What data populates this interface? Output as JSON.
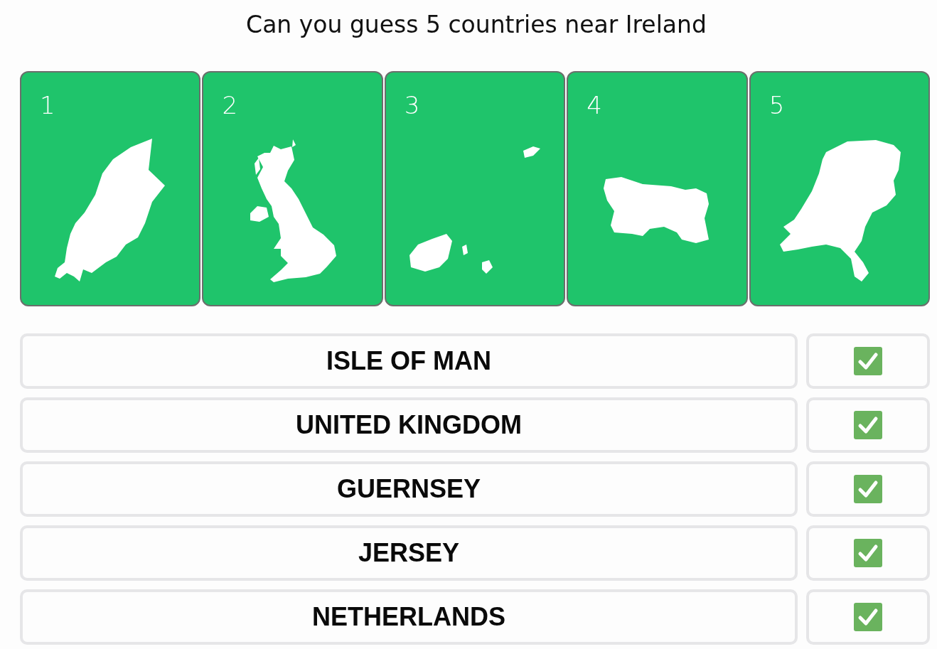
{
  "title": "Can you guess 5 countries near Ireland",
  "cards": [
    {
      "number": "1"
    },
    {
      "number": "2"
    },
    {
      "number": "3"
    },
    {
      "number": "4"
    },
    {
      "number": "5"
    }
  ],
  "answers": [
    {
      "name": "ISLE OF MAN",
      "correct": true
    },
    {
      "name": "UNITED KINGDOM",
      "correct": true
    },
    {
      "name": "GUERNSEY",
      "correct": true
    },
    {
      "name": "JERSEY",
      "correct": true
    },
    {
      "name": "NETHERLANDS",
      "correct": true
    }
  ]
}
